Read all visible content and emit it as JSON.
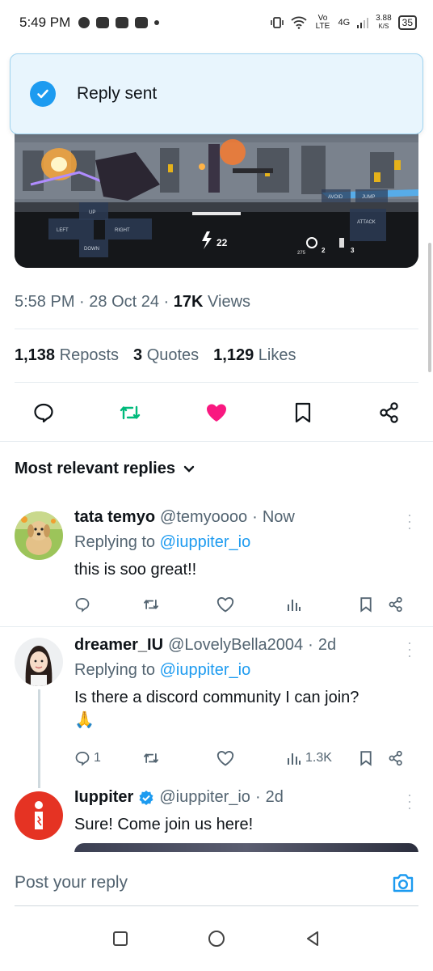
{
  "status_bar": {
    "time": "5:49 PM",
    "net_type": "4G",
    "net_speed": "3.88",
    "net_unit": "K/S",
    "volte": "Vo LTE",
    "battery": "35"
  },
  "toast": {
    "message": "Reply sent",
    "icon": "check-circle-icon"
  },
  "media": {
    "type": "game-screenshot",
    "labels": {
      "up": "UP",
      "left": "LEFT",
      "right": "RIGHT",
      "down": "DOWN",
      "avoid": "AVOID",
      "jump": "JUMP",
      "attack": "ATTACK",
      "energy": "22",
      "ammo_a": "2",
      "ammo_b": "3",
      "count": "275"
    }
  },
  "tweet": {
    "time": "5:58 PM",
    "date": "28 Oct 24",
    "views_count": "17K",
    "views_label": "Views",
    "reposts_count": "1,138",
    "reposts_label": "Reposts",
    "quotes_count": "3",
    "quotes_label": "Quotes",
    "likes_count": "1,129",
    "likes_label": "Likes",
    "colors": {
      "repost": "#00ba7c",
      "like": "#f91880"
    }
  },
  "replies_section": {
    "label": "Most relevant replies"
  },
  "replies": [
    {
      "name": "tata temyo",
      "handle": "@temyoooo",
      "time": "Now",
      "replying_prefix": "Replying to",
      "replying_to": "@iuppiter_io",
      "text": "this is soo great!!",
      "reply_count": "",
      "views": ""
    },
    {
      "name": "dreamer_IU",
      "handle": "@LovelyBella2004",
      "time": "2d",
      "replying_prefix": "Replying to",
      "replying_to": "@iuppiter_io",
      "text": "Is there a discord community I can join?",
      "emoji": "🙏",
      "reply_count": "1",
      "views": "1.3K"
    },
    {
      "name": "Iuppiter",
      "handle": "@iuppiter_io",
      "time": "2d",
      "verified": true,
      "text": "Sure! Come join us here!"
    }
  ],
  "compose": {
    "placeholder": "Post your reply",
    "icon": "camera-icon"
  },
  "nav": {
    "icons": [
      "recents-square-icon",
      "home-circle-icon",
      "back-triangle-icon"
    ]
  }
}
